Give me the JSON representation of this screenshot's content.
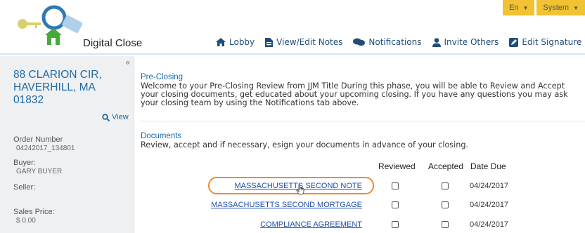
{
  "app": {
    "brand": "Digital Close"
  },
  "top_right": {
    "language": "En",
    "system": "System"
  },
  "nav": [
    {
      "label": "Lobby",
      "icon": "home-icon"
    },
    {
      "label": "View/Edit Notes",
      "icon": "notes-icon"
    },
    {
      "label": "Notifications",
      "icon": "chat-icon"
    },
    {
      "label": "Invite Others",
      "icon": "person-icon"
    },
    {
      "label": "Edit Signature",
      "icon": "edit-icon"
    }
  ],
  "sidebar": {
    "collapse": "«",
    "address_line1": "88 CLARION CIR,",
    "address_line2": "HAVERHILL, MA",
    "address_line3": "01832",
    "view_label": "View",
    "order_number_label": "Order Number",
    "order_number_value": "04242017_134801",
    "buyer_label": "Buyer:",
    "buyer_value": "GARY BUYER",
    "seller_label": "Seller:",
    "sales_price_label": "Sales Price:",
    "sales_price_value": "$ 0.00"
  },
  "preclosing": {
    "title": "Pre-Closing",
    "line1": "Welcome to your Pre-Closing Review from JJM Title During this phase, you will be able to Review and Accept",
    "line2": "your closing documents, get educated about your upcoming closing. If you have any questions you may ask",
    "line3": "your closing team by using the Notifications tab above."
  },
  "documents": {
    "title": "Documents",
    "subtitle": "Review, accept and if necessary, esign your documents in advance of your closing.",
    "headers": {
      "reviewed": "Reviewed",
      "accepted": "Accepted",
      "date_due": "Date Due"
    },
    "rows": [
      {
        "name": "MASSACHUSETTS SECOND NOTE",
        "reviewed": false,
        "accepted": false,
        "date_due": "04/24/2017"
      },
      {
        "name": "MASSACHUSETTS SECOND MORTGAGE",
        "reviewed": false,
        "accepted": false,
        "date_due": "04/24/2017"
      },
      {
        "name": "COMPLIANCE AGREEMENT",
        "reviewed": false,
        "accepted": false,
        "date_due": "04/24/2017"
      }
    ]
  },
  "colors": {
    "accent": "#1f6aa5",
    "dropdown": "#f1c232",
    "highlight": "#ef8b33"
  }
}
